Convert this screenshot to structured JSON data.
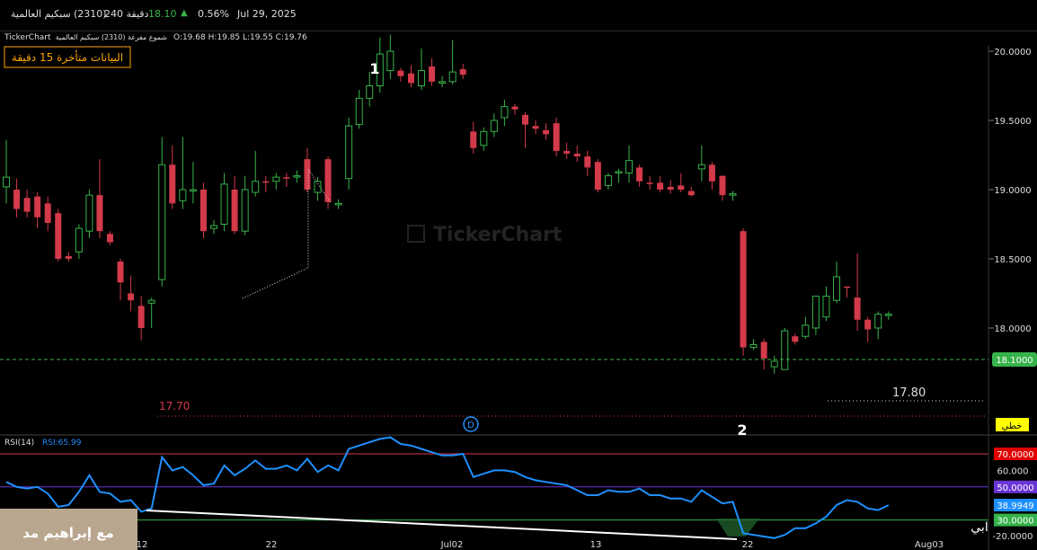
{
  "header": {
    "symbol_name": "سبكيم العالمية",
    "symbol_code": "(2310)",
    "interval": "240 دقيقة",
    "price": "18.10",
    "change_pct": "0.56%",
    "date": "Jul 29, 2025"
  },
  "info_bar": {
    "brand": "TickerChart",
    "series_label": "شموع مفرغة (2310) سبكيم العالمية",
    "ohlc": "O:19.68 H:19.85 L:19.55 C:19.76"
  },
  "delay_notice": "البيانات متأخرة 15 دقيقة",
  "watermark": "TickerChart",
  "badges": {
    "scale_mode": "خطي"
  },
  "annotations": {
    "wave_1": "1",
    "wave_2": "2",
    "low_left": "17.70",
    "low_right": "17.80",
    "dividend_marker": "D"
  },
  "rsi_label": "RSI(14)",
  "rsi_value_label": "RSI:65.99",
  "bottom_overlay": "مع إبراهيم مد",
  "bottom_overlay_right": "ابي",
  "colors": {
    "up": "#36b34a",
    "down": "#d33a4a",
    "rsi": "#1e90ff",
    "accent": "#ffa500"
  },
  "chart_data": [
    {
      "type": "candlestick",
      "title": "",
      "x_tick_labels": [
        "12",
        "22",
        "Jul02",
        "13",
        "22",
        "Aug03"
      ],
      "y_tick_labels": [
        "20.0000",
        "19.5000",
        "19.0000",
        "18.5000",
        "18.0000"
      ],
      "ylim": [
        17.55,
        20.22
      ],
      "current_price_label": "18.1000",
      "candles": [
        [
          19.02,
          19.09,
          18.9,
          19.36
        ],
        [
          19.0,
          18.86,
          18.8,
          19.08
        ],
        [
          18.94,
          18.84,
          18.8,
          19.0
        ],
        [
          18.95,
          18.8,
          18.72,
          18.98
        ],
        [
          18.9,
          18.76,
          18.7,
          18.95
        ],
        [
          18.83,
          18.5,
          18.48,
          18.86
        ],
        [
          18.52,
          18.5,
          18.48,
          18.55
        ],
        [
          18.55,
          18.72,
          18.5,
          18.75
        ],
        [
          18.7,
          18.96,
          18.65,
          19.0
        ],
        [
          18.96,
          18.7,
          18.65,
          19.22
        ],
        [
          18.68,
          18.62,
          18.6,
          18.7
        ],
        [
          18.48,
          18.33,
          18.2,
          18.5
        ],
        [
          18.25,
          18.2,
          18.12,
          18.38
        ],
        [
          18.16,
          18.0,
          17.91,
          18.23
        ],
        [
          18.18,
          18.2,
          18.0,
          18.22
        ],
        [
          18.35,
          19.18,
          18.3,
          19.38
        ],
        [
          19.18,
          18.9,
          18.86,
          19.32
        ],
        [
          18.92,
          19.0,
          18.86,
          19.38
        ],
        [
          19.0,
          19.0,
          18.9,
          19.2
        ],
        [
          19.0,
          18.7,
          18.65,
          19.05
        ],
        [
          18.72,
          18.74,
          18.68,
          18.78
        ],
        [
          18.75,
          19.04,
          18.7,
          19.12
        ],
        [
          19.0,
          18.7,
          18.68,
          19.1
        ],
        [
          18.7,
          19.0,
          18.67,
          19.1
        ],
        [
          18.98,
          19.06,
          18.95,
          19.28
        ],
        [
          19.06,
          19.05,
          18.98,
          19.1
        ],
        [
          19.06,
          19.09,
          19.0,
          19.12
        ],
        [
          19.09,
          19.08,
          19.02,
          19.12
        ],
        [
          19.1,
          19.1,
          19.05,
          19.14
        ],
        [
          19.22,
          19.0,
          18.98,
          19.3
        ],
        [
          18.98,
          19.06,
          18.92,
          19.09
        ],
        [
          19.22,
          18.91,
          18.86,
          19.24
        ],
        [
          18.9,
          18.9,
          18.86,
          18.93
        ],
        [
          19.08,
          19.46,
          19.0,
          19.52
        ],
        [
          19.47,
          19.66,
          19.44,
          19.72
        ],
        [
          19.66,
          19.75,
          19.6,
          19.85
        ],
        [
          19.75,
          19.98,
          19.7,
          20.1
        ],
        [
          19.86,
          20.0,
          19.8,
          20.12
        ],
        [
          19.86,
          19.82,
          19.78,
          19.88
        ],
        [
          19.84,
          19.77,
          19.74,
          19.9
        ],
        [
          19.75,
          19.86,
          19.72,
          20.02
        ],
        [
          19.89,
          19.78,
          19.75,
          19.95
        ],
        [
          19.77,
          19.78,
          19.74,
          19.82
        ],
        [
          19.78,
          19.85,
          19.76,
          20.08
        ],
        [
          19.87,
          19.83,
          19.8,
          19.91
        ],
        [
          19.42,
          19.3,
          19.26,
          19.49
        ],
        [
          19.32,
          19.42,
          19.28,
          19.45
        ],
        [
          19.42,
          19.5,
          19.38,
          19.55
        ],
        [
          19.52,
          19.6,
          19.46,
          19.65
        ],
        [
          19.6,
          19.58,
          19.54,
          19.62
        ],
        [
          19.54,
          19.47,
          19.3,
          19.56
        ],
        [
          19.46,
          19.44,
          19.4,
          19.5
        ],
        [
          19.43,
          19.4,
          19.36,
          19.48
        ],
        [
          19.48,
          19.28,
          19.24,
          19.52
        ],
        [
          19.28,
          19.26,
          19.22,
          19.34
        ],
        [
          19.26,
          19.24,
          19.2,
          19.32
        ],
        [
          19.24,
          19.16,
          19.1,
          19.28
        ],
        [
          19.2,
          19.0,
          18.98,
          19.22
        ],
        [
          19.03,
          19.1,
          19.0,
          19.12
        ],
        [
          19.12,
          19.13,
          19.05,
          19.15
        ],
        [
          19.12,
          19.21,
          19.05,
          19.32
        ],
        [
          19.16,
          19.06,
          19.02,
          19.18
        ],
        [
          19.05,
          19.04,
          19.0,
          19.1
        ],
        [
          19.05,
          19.0,
          18.98,
          19.1
        ],
        [
          19.02,
          19.0,
          18.97,
          19.07
        ],
        [
          19.03,
          19.0,
          18.98,
          19.12
        ],
        [
          18.99,
          18.96,
          18.95,
          19.02
        ],
        [
          19.15,
          19.18,
          19.06,
          19.32
        ],
        [
          19.18,
          19.06,
          19.0,
          19.2
        ],
        [
          19.1,
          18.96,
          18.92,
          19.1
        ],
        [
          18.96,
          18.97,
          18.92,
          18.99
        ],
        [
          18.7,
          17.86,
          17.8,
          18.72
        ],
        [
          17.86,
          17.88,
          17.84,
          17.92
        ],
        [
          17.9,
          17.78,
          17.7,
          17.92
        ],
        [
          17.72,
          17.76,
          17.67,
          17.8
        ],
        [
          17.7,
          17.98,
          17.7,
          18.0
        ],
        [
          17.94,
          17.9,
          17.88,
          17.96
        ],
        [
          17.94,
          18.02,
          17.92,
          18.08
        ],
        [
          18.0,
          18.23,
          17.95,
          18.23
        ],
        [
          18.08,
          18.23,
          18.05,
          18.3
        ],
        [
          18.2,
          18.37,
          18.18,
          18.48
        ],
        [
          18.3,
          18.29,
          18.22,
          18.3
        ],
        [
          18.22,
          18.06,
          17.98,
          18.54
        ],
        [
          18.06,
          17.99,
          17.9,
          18.08
        ],
        [
          18.0,
          18.1,
          17.92,
          18.12
        ],
        [
          18.1,
          18.1,
          18.06,
          18.12
        ]
      ]
    },
    {
      "type": "line",
      "title": "",
      "series": [
        {
          "name": "RSI:65.99",
          "values": [
            53,
            50,
            49,
            50,
            46,
            38,
            39,
            47,
            57,
            47,
            46,
            41,
            42,
            35,
            37,
            68,
            60,
            62,
            57,
            51,
            52,
            63,
            57,
            61,
            66,
            61,
            61,
            63,
            60,
            67,
            59,
            63,
            60,
            73,
            75,
            77,
            79,
            80,
            76,
            75,
            73,
            71,
            69,
            69,
            70,
            56,
            58,
            60,
            60,
            59,
            56,
            54,
            53,
            52,
            51,
            48,
            45,
            45,
            48,
            47,
            47,
            49,
            45,
            45,
            43,
            43,
            41,
            48,
            44,
            40,
            41,
            22,
            21,
            20,
            19,
            21,
            25,
            25,
            28,
            32,
            39,
            42,
            41,
            37,
            36,
            38.99
          ]
        }
      ],
      "y_tick_labels": [
        "70.0000",
        "60.000",
        "50.0000",
        "38.9949",
        "30.0000",
        "-20.0000"
      ],
      "ylim": [
        20,
        80
      ]
    }
  ]
}
